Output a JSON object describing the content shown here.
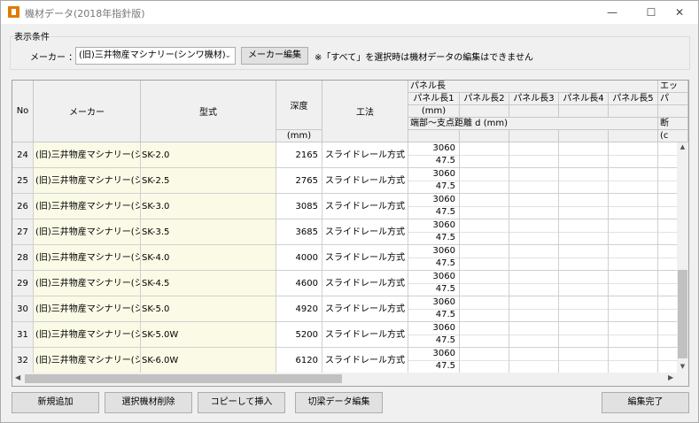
{
  "window": {
    "title": "機材データ(2018年指針版)",
    "min_glyph": "—",
    "max_glyph": "☐",
    "close_glyph": "✕"
  },
  "conditions": {
    "legend": "表示条件",
    "maker_label": "メーカー ：",
    "maker_value": "(旧)三井物産マシナリー(シンワ機材)",
    "maker_edit_button": "メーカー編集",
    "note": "※「すべて」を選択時は機材データの編集はできません"
  },
  "grid": {
    "headers": {
      "no": "No",
      "maker": "メーカー",
      "model": "型式",
      "depth": "深度",
      "depth_unit": "(mm)",
      "method": "工法",
      "panel_group": "パネル長",
      "panel_cols": [
        "パネル長1",
        "パネル長2",
        "パネル長3",
        "パネル長4",
        "パネル長5",
        "パ"
      ],
      "panel_unit": "(mm)",
      "support_label": "端部～支点距離 d (mm)",
      "extra_group": "エッ",
      "extra_sub": "断",
      "extra_unit": "(c"
    },
    "rows": [
      {
        "no": "24",
        "maker": "(旧)三井物産マシナリー(シンワ機材)",
        "model": "SK-2.0",
        "depth": "2165",
        "method": "スライドレール方式",
        "panel1": "3060",
        "d": "47.5"
      },
      {
        "no": "25",
        "maker": "(旧)三井物産マシナリー(シンワ機材)",
        "model": "SK-2.5",
        "depth": "2765",
        "method": "スライドレール方式",
        "panel1": "3060",
        "d": "47.5"
      },
      {
        "no": "26",
        "maker": "(旧)三井物産マシナリー(シンワ機材)",
        "model": "SK-3.0",
        "depth": "3085",
        "method": "スライドレール方式",
        "panel1": "3060",
        "d": "47.5"
      },
      {
        "no": "27",
        "maker": "(旧)三井物産マシナリー(シンワ機材)",
        "model": "SK-3.5",
        "depth": "3685",
        "method": "スライドレール方式",
        "panel1": "3060",
        "d": "47.5"
      },
      {
        "no": "28",
        "maker": "(旧)三井物産マシナリー(シンワ機材)",
        "model": "SK-4.0",
        "depth": "4000",
        "method": "スライドレール方式",
        "panel1": "3060",
        "d": "47.5"
      },
      {
        "no": "29",
        "maker": "(旧)三井物産マシナリー(シンワ機材)",
        "model": "SK-4.5",
        "depth": "4600",
        "method": "スライドレール方式",
        "panel1": "3060",
        "d": "47.5"
      },
      {
        "no": "30",
        "maker": "(旧)三井物産マシナリー(シンワ機材)",
        "model": "SK-5.0",
        "depth": "4920",
        "method": "スライドレール方式",
        "panel1": "3060",
        "d": "47.5"
      },
      {
        "no": "31",
        "maker": "(旧)三井物産マシナリー(シンワ機材)",
        "model": "SK-5.0W",
        "depth": "5200",
        "method": "スライドレール方式",
        "panel1": "3060",
        "d": "47.5"
      },
      {
        "no": "32",
        "maker": "(旧)三井物産マシナリー(シンワ機材)",
        "model": "SK-6.0W",
        "depth": "6120",
        "method": "スライドレール方式",
        "panel1": "3060",
        "d": "47.5"
      }
    ]
  },
  "buttons": {
    "add_new": "新規追加",
    "delete_selected": "選択機材削除",
    "copy_insert": "コピーして挿入",
    "beam_edit": "切梁データ編集",
    "done": "編集完了"
  }
}
